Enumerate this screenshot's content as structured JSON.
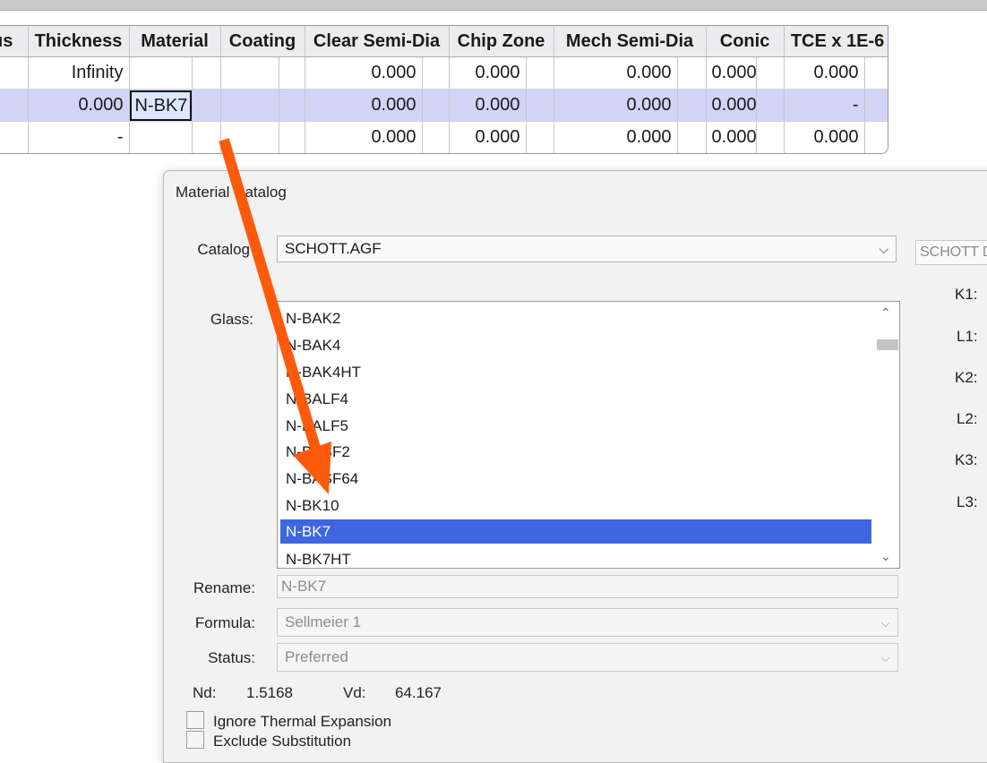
{
  "grid": {
    "headers": [
      "us",
      "Thickness",
      "Material",
      "",
      "Coating",
      "",
      "Clear Semi-Dia",
      "",
      "Chip Zone",
      "",
      "Mech Semi-Dia",
      "",
      "Conic",
      "",
      "TCE x 1E-6",
      ""
    ],
    "rows": [
      [
        "",
        "Infinity",
        "",
        "",
        "",
        "",
        "0.000",
        "",
        "0.000",
        "",
        "0.000",
        "",
        "0.000",
        "",
        "0.000",
        ""
      ],
      [
        "",
        "0.000",
        "N-BK7",
        "",
        "",
        "",
        "0.000",
        "",
        "0.000",
        "",
        "0.000",
        "",
        "0.000",
        "",
        "-",
        ""
      ],
      [
        "",
        "-",
        "",
        "",
        "",
        "",
        "0.000",
        "",
        "0.000",
        "",
        "0.000",
        "",
        "0.000",
        "",
        "0.000",
        ""
      ]
    ],
    "selected_row": 1,
    "editing_cell": "N-BK7"
  },
  "dialog": {
    "title": "Material Catalog",
    "catalog_label": "Catalog",
    "catalog_value": "SCHOTT.AGF",
    "catalog_desc": "SCHOTT D",
    "glass_label": "Glass:",
    "glass_list": [
      "N-BAK2",
      "N-BAK4",
      "N-BAK4HT",
      "N-BALF4",
      "N-BALF5",
      "N-BASF2",
      "N-BASF64",
      "N-BK10",
      "N-BK7",
      "N-BK7HT"
    ],
    "selected_glass": "N-BK7",
    "coefficient_labels": [
      "K1:",
      "L1:",
      "K2:",
      "L2:",
      "K3:",
      "L3:"
    ],
    "rename_label": "Rename:",
    "rename_value": "N-BK7",
    "formula_label": "Formula:",
    "formula_value": "Sellmeier 1",
    "status_label": "Status:",
    "status_value": "Preferred",
    "nd_label": "Nd:",
    "nd_value": "1.5168",
    "vd_label": "Vd:",
    "vd_value": "64.167",
    "ignore_thermal_label": "Ignore Thermal Expansion",
    "exclude_substitution_label": "Exclude Substitution"
  },
  "colors": {
    "selected_row": "#d2d4f6",
    "list_highlight": "#3f65e0",
    "arrow": "#ff5a0a"
  }
}
